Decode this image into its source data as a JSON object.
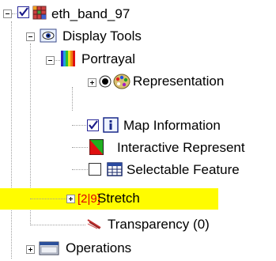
{
  "tree": {
    "root": {
      "label": "eth_band_97",
      "checked": true,
      "expanded": true
    },
    "display_tools": {
      "label": "Display Tools",
      "expanded": true
    },
    "portrayal": {
      "label": "Portrayal",
      "expanded": true
    },
    "representation": {
      "label": "Representation",
      "expanded": false
    },
    "map_information": {
      "label": "Map Information",
      "checked": true
    },
    "interactive_representation": {
      "label": "Interactive Represent"
    },
    "selectable_features": {
      "label": "Selectable Feature",
      "checked": false
    },
    "stretch": {
      "label": "Stretch",
      "icon_text": "[2|9]",
      "expanded": false,
      "highlighted": true
    },
    "transparency": {
      "label": "Transparency (0)"
    },
    "operations": {
      "label": "Operations",
      "expanded": false
    }
  },
  "colors": {
    "highlight": "#fffc00",
    "stretch_text": "#e00000"
  }
}
